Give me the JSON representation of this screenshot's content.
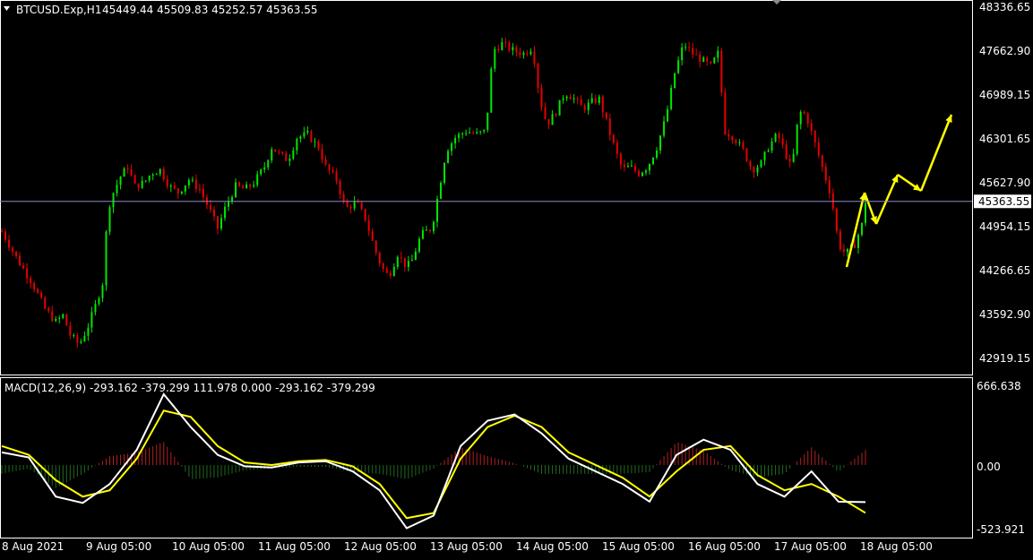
{
  "price_panel": {
    "symbol_label": "BTCUSD.Exp,H1",
    "ohlc_text": "45449.44 45509.83 45252.57 45363.55",
    "price_scale": [
      "48336.65",
      "47662.90",
      "46989.15",
      "46301.65",
      "45627.90",
      "44954.15",
      "44266.65",
      "43592.90",
      "42919.15"
    ],
    "current_price_label": "45363.55"
  },
  "macd_panel": {
    "title": "MACD(12,26,9) -293.162 -379.299 111.978 0.000 -293.162 -379.299",
    "scale": [
      "666.638",
      "0.00",
      "-523.921"
    ]
  },
  "time_axis": [
    "8 Aug 2021",
    "9 Aug 05:00",
    "10 Aug 05:00",
    "11 Aug 05:00",
    "12 Aug 05:00",
    "13 Aug 05:00",
    "14 Aug 05:00",
    "15 Aug 05:00",
    "16 Aug 05:00",
    "17 Aug 05:00",
    "18 Aug 05:00"
  ],
  "colors": {
    "bull": "#00e600",
    "bear": "#e60000",
    "macd_main": "#ffffff",
    "macd_signal": "#ffff00",
    "hist_pos": "#b22222",
    "hist_neg": "#1f6b1f",
    "forecast": "#ffff00",
    "price_line": "#8c8cc8"
  },
  "chart_data": [
    {
      "type": "candlestick",
      "title": "BTCUSD.Exp,H1",
      "x_unit": "hourly bars",
      "ylim": [
        42700,
        48450
      ],
      "current_price": 45363.55,
      "close_path": [
        [
          0,
          44900
        ],
        [
          18,
          44450
        ],
        [
          34,
          44100
        ],
        [
          48,
          43700
        ],
        [
          60,
          43500
        ],
        [
          68,
          43600
        ],
        [
          76,
          43300
        ],
        [
          86,
          43150
        ],
        [
          95,
          43400
        ],
        [
          104,
          43750
        ],
        [
          112,
          44100
        ],
        [
          118,
          45250
        ],
        [
          124,
          45500
        ],
        [
          132,
          45750
        ],
        [
          140,
          45900
        ],
        [
          148,
          45600
        ],
        [
          158,
          45650
        ],
        [
          166,
          45800
        ],
        [
          176,
          45850
        ],
        [
          186,
          45600
        ],
        [
          196,
          45500
        ],
        [
          208,
          45700
        ],
        [
          220,
          45550
        ],
        [
          232,
          45200
        ],
        [
          240,
          44950
        ],
        [
          248,
          45250
        ],
        [
          260,
          45600
        ],
        [
          270,
          45550
        ],
        [
          280,
          45650
        ],
        [
          292,
          45900
        ],
        [
          300,
          46200
        ],
        [
          308,
          46100
        ],
        [
          318,
          46000
        ],
        [
          328,
          46350
        ],
        [
          340,
          46400
        ],
        [
          352,
          46200
        ],
        [
          360,
          45900
        ],
        [
          372,
          45700
        ],
        [
          382,
          45250
        ],
        [
          394,
          45350
        ],
        [
          404,
          45100
        ],
        [
          414,
          44650
        ],
        [
          422,
          44350
        ],
        [
          430,
          44200
        ],
        [
          440,
          44550
        ],
        [
          450,
          44350
        ],
        [
          456,
          44450
        ],
        [
          466,
          44850
        ],
        [
          478,
          44950
        ],
        [
          486,
          45550
        ],
        [
          494,
          46150
        ],
        [
          504,
          46350
        ],
        [
          516,
          46450
        ],
        [
          528,
          46400
        ],
        [
          538,
          46450
        ],
        [
          546,
          47700
        ],
        [
          556,
          47800
        ],
        [
          568,
          47700
        ],
        [
          580,
          47650
        ],
        [
          590,
          47750
        ],
        [
          598,
          46950
        ],
        [
          606,
          46550
        ],
        [
          616,
          46750
        ],
        [
          626,
          47050
        ],
        [
          636,
          46950
        ],
        [
          646,
          46800
        ],
        [
          656,
          46900
        ],
        [
          664,
          46950
        ],
        [
          674,
          46500
        ],
        [
          682,
          46150
        ],
        [
          690,
          45850
        ],
        [
          698,
          45900
        ],
        [
          708,
          45800
        ],
        [
          718,
          45900
        ],
        [
          728,
          46200
        ],
        [
          738,
          46650
        ],
        [
          748,
          47350
        ],
        [
          758,
          47800
        ],
        [
          768,
          47650
        ],
        [
          778,
          47550
        ],
        [
          788,
          47450
        ],
        [
          796,
          47650
        ],
        [
          804,
          46450
        ],
        [
          814,
          46350
        ],
        [
          824,
          46150
        ],
        [
          834,
          45850
        ],
        [
          844,
          45950
        ],
        [
          852,
          46200
        ],
        [
          862,
          46400
        ],
        [
          870,
          46150
        ],
        [
          878,
          45850
        ],
        [
          886,
          46750
        ],
        [
          894,
          46700
        ],
        [
          904,
          46250
        ],
        [
          914,
          45800
        ],
        [
          922,
          45450
        ],
        [
          930,
          44700
        ],
        [
          938,
          44550
        ],
        [
          948,
          44700
        ],
        [
          956,
          45000
        ],
        [
          960,
          45363.55
        ]
      ],
      "close_path_x_note": "x values are hourly bar offsets from 8 Aug 2021"
    },
    {
      "type": "line",
      "title": "MACD(12,26,9)",
      "ylim": [
        -560,
        680
      ],
      "main_value": -293.162,
      "signal_value": -379.299,
      "series": [
        {
          "name": "MACD",
          "values": [
            [
              0,
              100
            ],
            [
              30,
              60
            ],
            [
              60,
              -250
            ],
            [
              90,
              -300
            ],
            [
              120,
              -150
            ],
            [
              150,
              120
            ],
            [
              180,
              560
            ],
            [
              210,
              300
            ],
            [
              240,
              80
            ],
            [
              270,
              -10
            ],
            [
              300,
              -20
            ],
            [
              330,
              20
            ],
            [
              360,
              30
            ],
            [
              390,
              -50
            ],
            [
              420,
              -200
            ],
            [
              450,
              -500
            ],
            [
              480,
              -400
            ],
            [
              510,
              150
            ],
            [
              540,
              350
            ],
            [
              570,
              400
            ],
            [
              600,
              250
            ],
            [
              630,
              50
            ],
            [
              660,
              -50
            ],
            [
              690,
              -150
            ],
            [
              720,
              -290
            ],
            [
              750,
              80
            ],
            [
              780,
              200
            ],
            [
              810,
              120
            ],
            [
              840,
              -150
            ],
            [
              870,
              -250
            ],
            [
              900,
              -50
            ],
            [
              930,
              -290
            ],
            [
              960,
              -293
            ]
          ]
        },
        {
          "name": "Signal",
          "values": [
            [
              0,
              150
            ],
            [
              30,
              80
            ],
            [
              60,
              -120
            ],
            [
              90,
              -250
            ],
            [
              120,
              -200
            ],
            [
              150,
              50
            ],
            [
              180,
              430
            ],
            [
              210,
              380
            ],
            [
              240,
              150
            ],
            [
              270,
              20
            ],
            [
              300,
              0
            ],
            [
              330,
              30
            ],
            [
              360,
              40
            ],
            [
              390,
              -10
            ],
            [
              420,
              -150
            ],
            [
              450,
              -420
            ],
            [
              480,
              -380
            ],
            [
              510,
              50
            ],
            [
              540,
              300
            ],
            [
              570,
              390
            ],
            [
              600,
              300
            ],
            [
              630,
              100
            ],
            [
              660,
              0
            ],
            [
              690,
              -100
            ],
            [
              720,
              -250
            ],
            [
              750,
              -50
            ],
            [
              780,
              120
            ],
            [
              810,
              150
            ],
            [
              840,
              -80
            ],
            [
              870,
              -200
            ],
            [
              900,
              -150
            ],
            [
              930,
              -250
            ],
            [
              960,
              -379
            ]
          ]
        }
      ]
    }
  ]
}
